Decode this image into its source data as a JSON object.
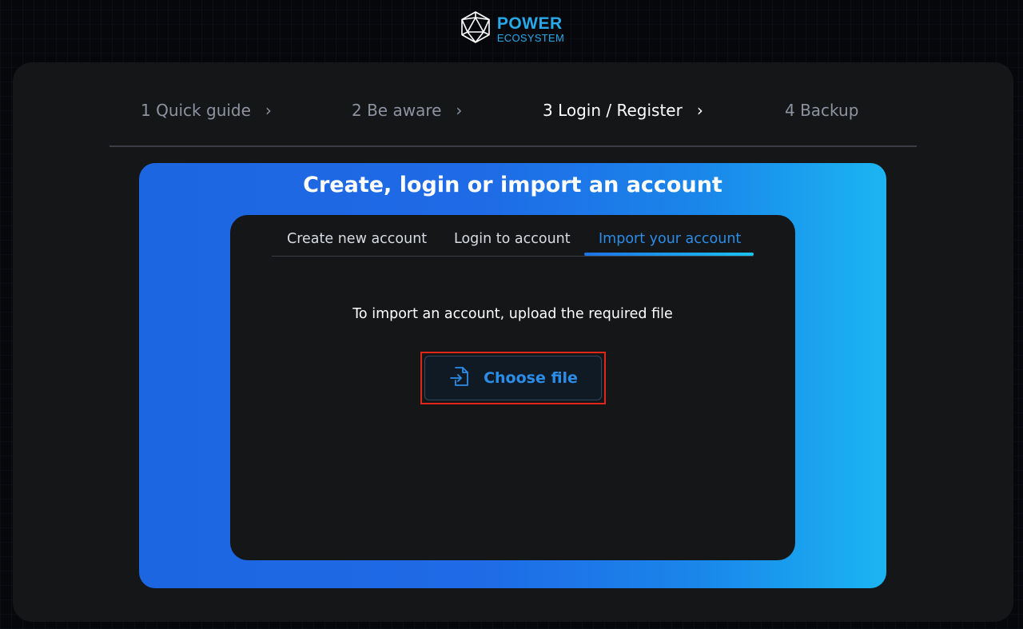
{
  "header": {
    "logo_title": "POWER",
    "logo_subtitle": "ECOSYSTEM",
    "logo_icon": "polyhedron-logo-icon",
    "brand_color": "#28a9e9"
  },
  "steps": [
    {
      "number": "1",
      "label": "1 Quick guide",
      "active": false
    },
    {
      "number": "2",
      "label": "2 Be aware",
      "active": false
    },
    {
      "number": "3",
      "label": "3 Login / Register",
      "active": true
    },
    {
      "number": "4",
      "label": "4 Backup",
      "active": false
    }
  ],
  "step_separator_icon": "chevron-right-icon",
  "panel": {
    "title": "Create, login or import an account",
    "tabs": [
      {
        "label": "Create new account",
        "active": false
      },
      {
        "label": "Login to account",
        "active": false
      },
      {
        "label": "Import your account",
        "active": true
      }
    ],
    "hint": "To import an account, upload the required file",
    "choose_button": {
      "label": "Choose file",
      "icon": "file-import-icon",
      "highlighted": true
    }
  },
  "colors": {
    "accent": "#2b8de8",
    "gradient_start": "#1d66e2",
    "gradient_end": "#1bb5f2",
    "highlight_border": "#e0251b",
    "card_bg": "#151618"
  }
}
